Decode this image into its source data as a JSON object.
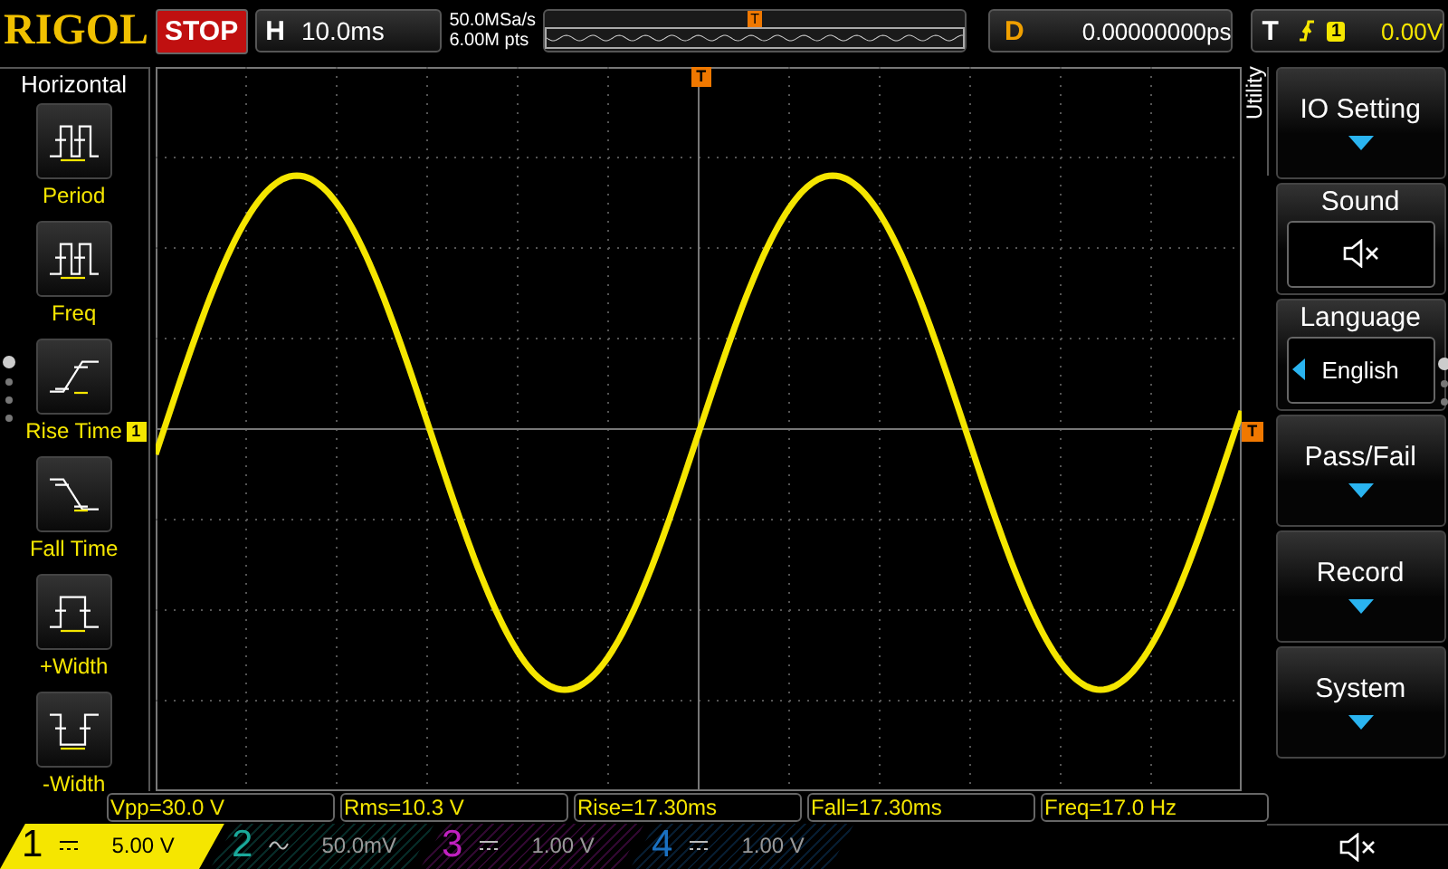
{
  "top_bar": {
    "logo": "RIGOL",
    "run_state": "STOP",
    "horizontal": {
      "label": "H",
      "timebase": "10.0ms"
    },
    "sample_rate": "50.0MSa/s",
    "memory_depth": "6.00M pts",
    "memory_trigger_marker": "T",
    "delay": {
      "label": "D",
      "value": "0.00000000ps"
    },
    "trigger": {
      "label": "T",
      "source": "1",
      "level": "0.00V"
    }
  },
  "left_menu": {
    "title": "Horizontal",
    "items": [
      {
        "kind": "period",
        "label": "Period"
      },
      {
        "kind": "freq",
        "label": "Freq"
      },
      {
        "kind": "rise",
        "label": "Rise Time"
      },
      {
        "kind": "fall",
        "label": "Fall Time"
      },
      {
        "kind": "pwidth",
        "label": "+Width"
      },
      {
        "kind": "nwidth",
        "label": "-Width"
      }
    ]
  },
  "screen": {
    "trigger_position_marker": "T",
    "trigger_level_marker": "T",
    "channel_marker": "1"
  },
  "right_menu": {
    "title": "Utility",
    "items": [
      {
        "kind": "submenu",
        "label": "IO Setting"
      },
      {
        "kind": "mute",
        "label": "Sound",
        "muted": true
      },
      {
        "kind": "option",
        "label": "Language",
        "value": "English"
      },
      {
        "kind": "submenu",
        "label": "Pass/Fail"
      },
      {
        "kind": "submenu",
        "label": "Record"
      },
      {
        "kind": "submenu",
        "label": "System"
      }
    ]
  },
  "measurements": [
    "Vpp=30.0 V",
    "Rms=10.3 V",
    "Rise=17.30ms",
    "Fall=17.30ms",
    "Freq=17.0 Hz"
  ],
  "channels": [
    {
      "number": "1",
      "kind": "dc",
      "scale": "5.00 V",
      "selected": true,
      "color": "#f5e600"
    },
    {
      "number": "2",
      "kind": "ac",
      "scale": "50.0mV",
      "selected": false,
      "color": "#1aa89a"
    },
    {
      "number": "3",
      "kind": "dc",
      "scale": "1.00 V",
      "selected": false,
      "color": "#c020c0"
    },
    {
      "number": "4",
      "kind": "dc",
      "scale": "1.00 V",
      "selected": false,
      "color": "#1a70c0"
    }
  ]
}
